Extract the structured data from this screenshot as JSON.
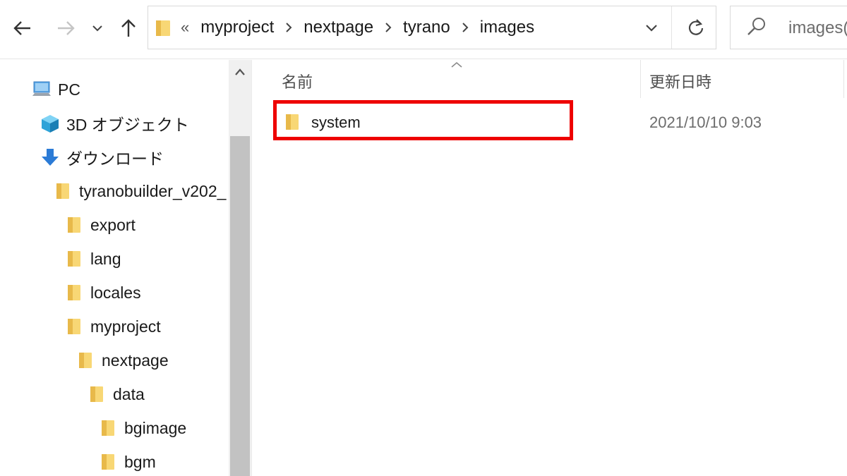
{
  "navigation": {
    "back_icon": "arrow-left-icon",
    "forward_icon": "arrow-right-icon",
    "recent_icon": "chevron-down-icon",
    "up_icon": "arrow-up-icon"
  },
  "address_bar": {
    "overflow_chevron": "«",
    "crumbs": [
      "myproject",
      "nextpage",
      "tyrano",
      "images"
    ],
    "dropdown_icon": "chevron-down-icon",
    "refresh_icon": "refresh-icon"
  },
  "search": {
    "text": "images(",
    "icon": "search-icon"
  },
  "nav_pane": {
    "items": [
      {
        "label": "PC",
        "icon": "pc-icon"
      },
      {
        "label": "3D オブジェクト",
        "icon": "3d-objects-icon"
      },
      {
        "label": "ダウンロード",
        "icon": "download-icon"
      },
      {
        "label": "tyranobuilder_v202_",
        "icon": "folder-icon"
      },
      {
        "label": "export",
        "icon": "folder-icon"
      },
      {
        "label": "lang",
        "icon": "folder-icon"
      },
      {
        "label": "locales",
        "icon": "folder-icon"
      },
      {
        "label": "myproject",
        "icon": "folder-icon"
      },
      {
        "label": "nextpage",
        "icon": "folder-icon"
      },
      {
        "label": "data",
        "icon": "folder-icon"
      },
      {
        "label": "bgimage",
        "icon": "folder-icon"
      },
      {
        "label": "bgm",
        "icon": "folder-icon"
      }
    ]
  },
  "content": {
    "columns": {
      "name": "名前",
      "modified": "更新日時"
    },
    "files": [
      {
        "name": "system",
        "modified": "2021/10/10 9:03",
        "icon": "folder-icon",
        "highlighted": true
      }
    ]
  },
  "colors": {
    "highlight": "#ee0000",
    "folder_yellow": "#f8d775",
    "folder_dark": "#e0b03e",
    "download_blue": "#2b7bd6"
  }
}
